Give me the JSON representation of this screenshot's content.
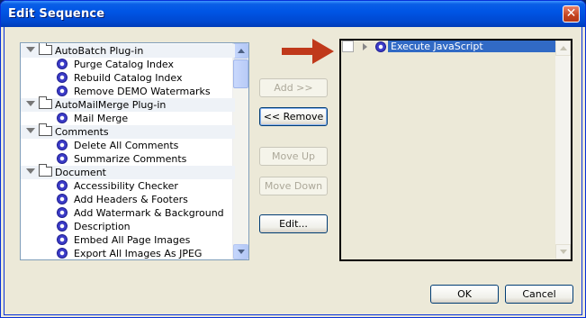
{
  "window": {
    "title": "Edit Sequence"
  },
  "left_tree": {
    "rows": [
      {
        "kind": "category",
        "label": "AutoBatch Plug-in"
      },
      {
        "kind": "item",
        "label": "Purge Catalog Index"
      },
      {
        "kind": "item",
        "label": "Rebuild Catalog Index"
      },
      {
        "kind": "item",
        "label": "Remove DEMO Watermarks"
      },
      {
        "kind": "category",
        "label": "AutoMailMerge Plug-in"
      },
      {
        "kind": "item",
        "label": "Mail Merge"
      },
      {
        "kind": "category",
        "label": "Comments"
      },
      {
        "kind": "item",
        "label": "Delete All Comments"
      },
      {
        "kind": "item",
        "label": "Summarize Comments"
      },
      {
        "kind": "category",
        "label": "Document"
      },
      {
        "kind": "item",
        "label": "Accessibility Checker"
      },
      {
        "kind": "item",
        "label": "Add Headers & Footers"
      },
      {
        "kind": "item",
        "label": "Add Watermark & Background"
      },
      {
        "kind": "item",
        "label": "Description"
      },
      {
        "kind": "item",
        "label": "Embed All Page Images"
      },
      {
        "kind": "item",
        "label": "Export All Images As JPEG"
      }
    ]
  },
  "buttons": {
    "add": "Add >>",
    "remove": "<< Remove",
    "move_up": "Move Up",
    "move_down": "Move Down",
    "edit": "Edit...",
    "ok": "OK",
    "cancel": "Cancel"
  },
  "right_list": {
    "items": [
      {
        "label": "Execute JavaScript",
        "selected": true,
        "checked": false
      }
    ]
  },
  "colors": {
    "selection": "#316ac5",
    "arrow": "#c0391b",
    "title_bar": "#0055e5"
  }
}
